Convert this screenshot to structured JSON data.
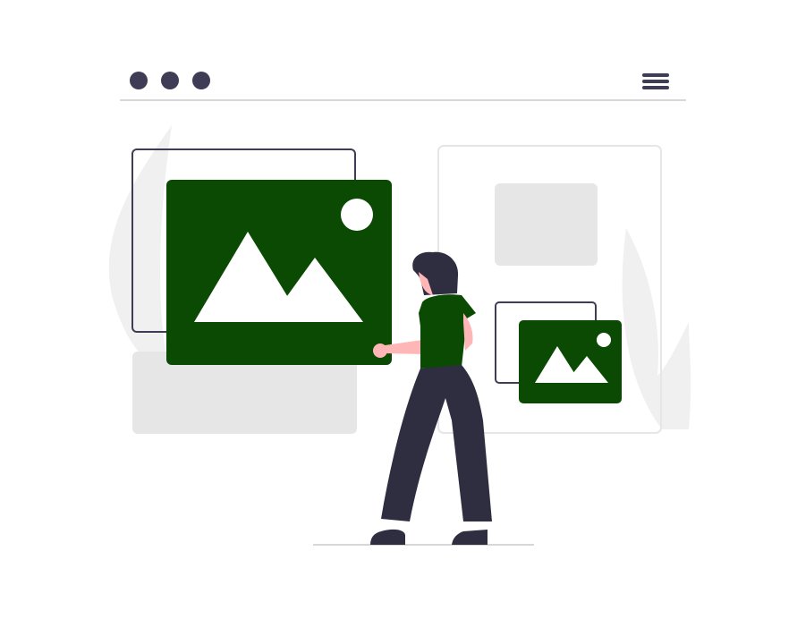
{
  "window": {
    "controls": [
      "dot",
      "dot",
      "dot"
    ],
    "menu_icon": "hamburger-menu-icon"
  },
  "colors": {
    "accent_green": "#0a4a03",
    "dark": "#3f3d56",
    "navy_dark": "#2f2e41",
    "light_gray": "#e6e6e6",
    "lighter_gray": "#f2f2f2",
    "skin": "#ffb6b6",
    "white": "#ffffff"
  },
  "icons": {
    "image_card_large": "image-placeholder-icon",
    "image_card_small": "image-placeholder-icon"
  }
}
